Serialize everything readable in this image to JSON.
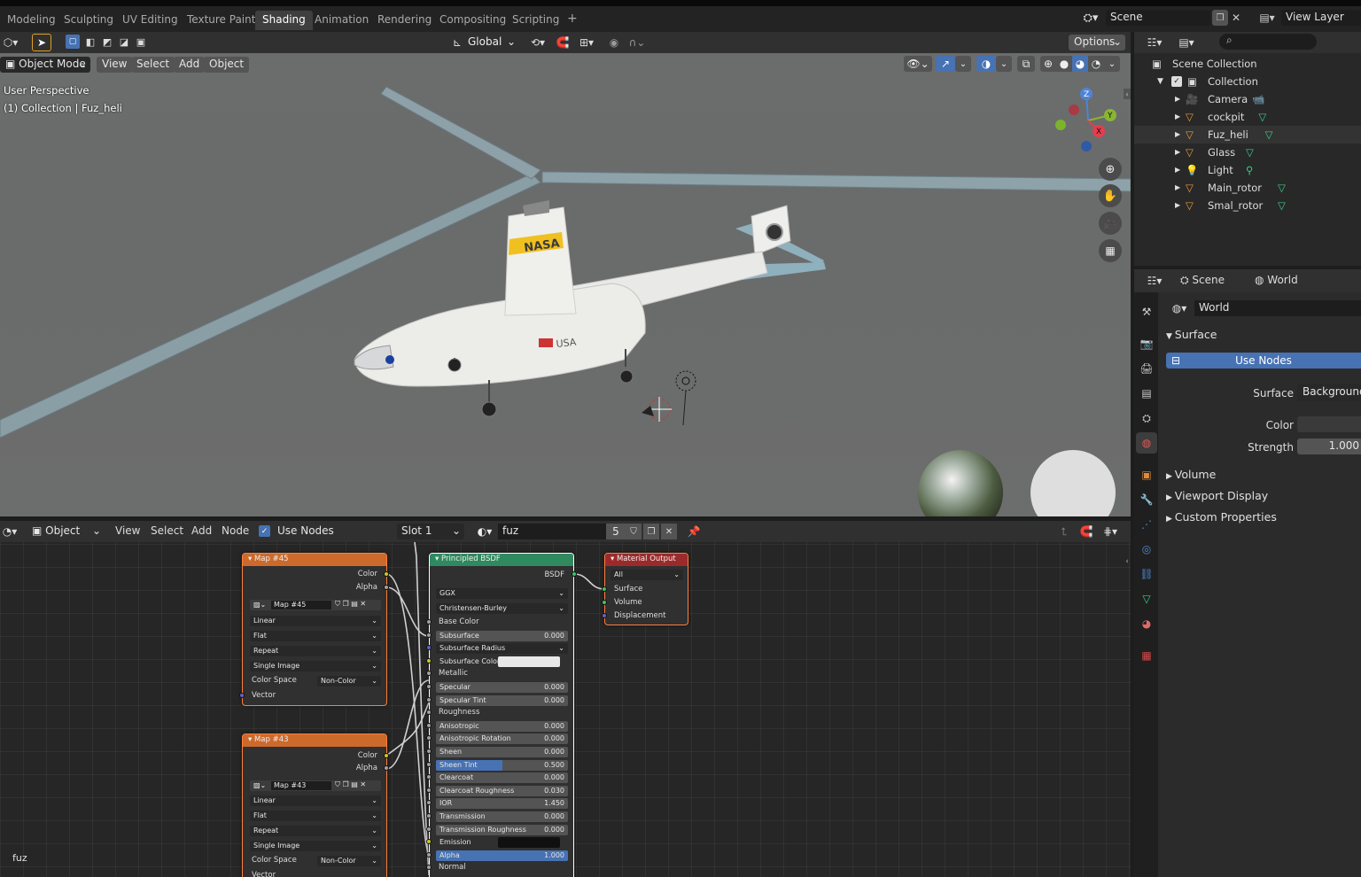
{
  "workspace_tabs": [
    "Modeling",
    "Sculpting",
    "UV Editing",
    "Texture Paint",
    "Shading",
    "Animation",
    "Rendering",
    "Compositing",
    "Scripting"
  ],
  "active_tab": "Shading",
  "scene_name": "Scene",
  "view_layer": "View Layer",
  "viewport": {
    "transform_orientation": "Global",
    "options_label": "Options",
    "mode": "Object Mode",
    "menu": [
      "View",
      "Select",
      "Add",
      "Object"
    ],
    "overlay_line1": "User Perspective",
    "overlay_line2": "(1) Collection | Fuz_heli",
    "gizmo_axes": {
      "z": "Z",
      "y": "Y",
      "x": "X"
    },
    "model_text": {
      "nasa": "NASA",
      "usa": "USA"
    }
  },
  "outliner": {
    "root": "Scene Collection",
    "collection": "Collection",
    "objects": [
      "Camera",
      "cockpit",
      "Fuz_heli",
      "Glass",
      "Light",
      "Main_rotor",
      "Smal_rotor"
    ]
  },
  "properties": {
    "tab_scene": "Scene",
    "tab_world": "World",
    "world_name": "World",
    "surface_panel": "Surface",
    "use_nodes_button": "Use Nodes",
    "surface_label": "Surface",
    "surface_value": "Background",
    "color_label": "Color",
    "strength_label": "Strength",
    "strength_value": "1.000",
    "panels_collapsed": [
      "Volume",
      "Viewport Display",
      "Custom Properties"
    ]
  },
  "node_editor": {
    "editor_type": "Object",
    "menu": [
      "View",
      "Select",
      "Add",
      "Node"
    ],
    "use_nodes_label": "Use Nodes",
    "slot": "Slot 1",
    "material_name": "fuz",
    "user_count": "5",
    "corner_label": "fuz",
    "map45": {
      "title": "Map #45",
      "out_color": "Color",
      "out_alpha": "Alpha",
      "image_name": "Map #45",
      "interpolation": "Linear",
      "projection": "Flat",
      "extension": "Repeat",
      "source": "Single Image",
      "color_space_label": "Color Space",
      "color_space_value": "Non-Color",
      "in_vector": "Vector"
    },
    "map43": {
      "title": "Map #43",
      "out_color": "Color",
      "out_alpha": "Alpha",
      "image_name": "Map #43",
      "interpolation": "Linear",
      "projection": "Flat",
      "extension": "Repeat",
      "source": "Single Image",
      "color_space_label": "Color Space",
      "color_space_value": "Non-Color",
      "in_vector": "Vector"
    },
    "bsdf": {
      "title": "Principled BSDF",
      "out": "BSDF",
      "distribution": "GGX",
      "subsurface_method": "Christensen-Burley",
      "rows": [
        {
          "label": "Base Color",
          "kind": "socket"
        },
        {
          "label": "Subsurface",
          "kind": "value",
          "value": "0.000"
        },
        {
          "label": "Subsurface Radius",
          "kind": "dropdown"
        },
        {
          "label": "Subsurface Color",
          "kind": "color"
        },
        {
          "label": "Metallic",
          "kind": "socket"
        },
        {
          "label": "Specular",
          "kind": "value",
          "value": "0.000"
        },
        {
          "label": "Specular Tint",
          "kind": "value",
          "value": "0.000"
        },
        {
          "label": "Roughness",
          "kind": "socket"
        },
        {
          "label": "Anisotropic",
          "kind": "value",
          "value": "0.000"
        },
        {
          "label": "Anisotropic Rotation",
          "kind": "value",
          "value": "0.000"
        },
        {
          "label": "Sheen",
          "kind": "value",
          "value": "0.000"
        },
        {
          "label": "Sheen Tint",
          "kind": "slider",
          "value": "0.500",
          "fill": 0.5
        },
        {
          "label": "Clearcoat",
          "kind": "value",
          "value": "0.000"
        },
        {
          "label": "Clearcoat Roughness",
          "kind": "value",
          "value": "0.030"
        },
        {
          "label": "IOR",
          "kind": "value",
          "value": "1.450"
        },
        {
          "label": "Transmission",
          "kind": "value",
          "value": "0.000"
        },
        {
          "label": "Transmission Roughness",
          "kind": "value",
          "value": "0.000"
        },
        {
          "label": "Emission",
          "kind": "colorblack"
        },
        {
          "label": "Alpha",
          "kind": "slider",
          "value": "1.000",
          "fill": 1.0
        },
        {
          "label": "Normal",
          "kind": "socket"
        }
      ]
    },
    "output": {
      "title": "Material Output",
      "target": "All",
      "inputs": [
        "Surface",
        "Volume",
        "Displacement"
      ]
    }
  },
  "colors": {
    "accent": "#4772b3",
    "node_texture": "#cc6a2c",
    "node_shader": "#2f8a5f",
    "node_output": "#9d2a2a",
    "selected_outline": "#ff7f3f"
  }
}
